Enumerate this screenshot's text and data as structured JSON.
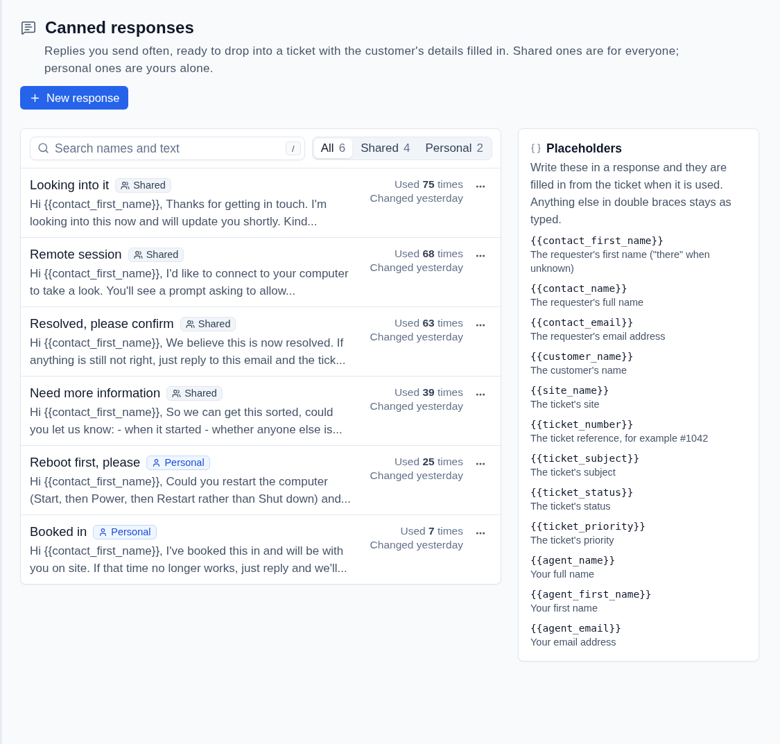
{
  "header": {
    "title": "Canned responses",
    "description": "Replies you send often, ready to drop into a ticket with the customer's details filled in. Shared ones are for everyone; personal ones are yours alone.",
    "new_button": {
      "label": "New response"
    }
  },
  "search": {
    "placeholder": "Search names and text",
    "shortcut": "/"
  },
  "filters": [
    {
      "label": "All",
      "count": "6",
      "selected": true
    },
    {
      "label": "Shared",
      "count": "4",
      "selected": false
    },
    {
      "label": "Personal",
      "count": "2",
      "selected": false
    }
  ],
  "responses": [
    {
      "title": "Looking into it",
      "tag": {
        "kind": "shared",
        "label": "Shared"
      },
      "snippet": "Hi {{contact_first_name}}, Thanks for getting in touch. I'm looking into this now and will update you shortly. Kind...",
      "usage": "Used **75** times",
      "changed": "Changed yesterday"
    },
    {
      "title": "Remote session",
      "tag": {
        "kind": "shared",
        "label": "Shared"
      },
      "snippet": "Hi {{contact_first_name}}, I'd like to connect to your computer to take a look. You'll see a prompt asking to allow...",
      "usage": "Used **68** times",
      "changed": "Changed yesterday"
    },
    {
      "title": "Resolved, please confirm",
      "tag": {
        "kind": "shared",
        "label": "Shared"
      },
      "snippet": "Hi {{contact_first_name}}, We believe this is now resolved. If anything is still not right, just reply to this email and the tick...",
      "usage": "Used **63** times",
      "changed": "Changed yesterday"
    },
    {
      "title": "Need more information",
      "tag": {
        "kind": "shared",
        "label": "Shared"
      },
      "snippet": "Hi {{contact_first_name}}, So we can get this sorted, could you let us know: - when it started - whether anyone else is...",
      "usage": "Used **39** times",
      "changed": "Changed yesterday"
    },
    {
      "title": "Reboot first, please",
      "tag": {
        "kind": "personal",
        "label": "Personal"
      },
      "snippet": "Hi {{contact_first_name}}, Could you restart the computer (Start, then Power, then Restart rather than Shut down) and...",
      "usage": "Used **25** times",
      "changed": "Changed yesterday"
    },
    {
      "title": "Booked in",
      "tag": {
        "kind": "personal",
        "label": "Personal"
      },
      "snippet": "Hi {{contact_first_name}}, I've booked this in and will be with you on site. If that time no longer works, just reply and we'll...",
      "usage": "Used **7** times",
      "changed": "Changed yesterday"
    }
  ],
  "placeholders": {
    "title": "Placeholders",
    "description": "Write these in a response and they are filled in from the ticket when it is used. Anything else in double braces stays as typed.",
    "items": [
      {
        "code": "{{contact_first_name}}",
        "description": "The requester's first name (\"there\" when unknown)"
      },
      {
        "code": "{{contact_name}}",
        "description": "The requester's full name"
      },
      {
        "code": "{{contact_email}}",
        "description": "The requester's email address"
      },
      {
        "code": "{{customer_name}}",
        "description": "The customer's name"
      },
      {
        "code": "{{site_name}}",
        "description": "The ticket's site"
      },
      {
        "code": "{{ticket_number}}",
        "description": "The ticket reference, for example #1042"
      },
      {
        "code": "{{ticket_subject}}",
        "description": "The ticket's subject"
      },
      {
        "code": "{{ticket_status}}",
        "description": "The ticket's status"
      },
      {
        "code": "{{ticket_priority}}",
        "description": "The ticket's priority"
      },
      {
        "code": "{{agent_name}}",
        "description": "Your full name"
      },
      {
        "code": "{{agent_first_name}}",
        "description": "Your first name"
      },
      {
        "code": "{{agent_email}}",
        "description": "Your email address"
      }
    ]
  }
}
